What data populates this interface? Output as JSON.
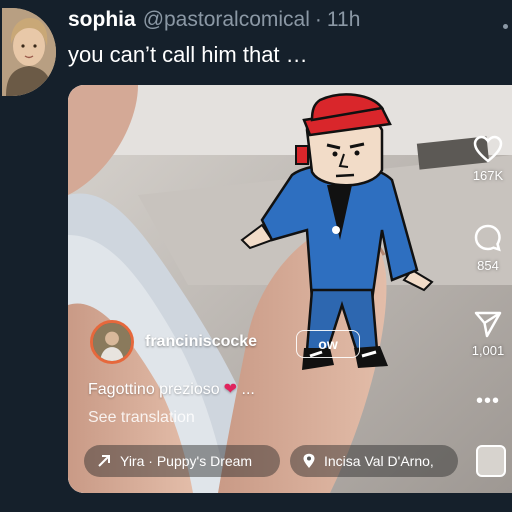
{
  "tweet": {
    "display_name": "sophia",
    "handle": "@pastoralcomical",
    "separator": "·",
    "time": "11h",
    "text": "you can’t call him that …"
  },
  "media": {
    "overlay": {
      "username": "franciniscocke",
      "follow_label": "ow",
      "caption": "Fagottino prezioso",
      "caption_suffix": "...",
      "translation": "See translation",
      "music": "Yira · Puppy's Dream",
      "location": "Incisa Val D'Arno,"
    },
    "side_actions": {
      "likes": "167K",
      "comments": "854",
      "shares": "1,001",
      "more": "•••"
    }
  },
  "icons": {
    "like": "heart-icon",
    "comment": "comment-icon",
    "share": "paper-plane-icon",
    "music": "arrow-icon",
    "location": "location-pin-icon",
    "caption_emoji": "red-heart-emoji"
  },
  "colors": {
    "background": "#15202b",
    "secondary_text": "#8b98a5",
    "heart": "#e0245e",
    "cartoon_jacket": "#2e6fc0",
    "cartoon_cap": "#d9262b"
  }
}
